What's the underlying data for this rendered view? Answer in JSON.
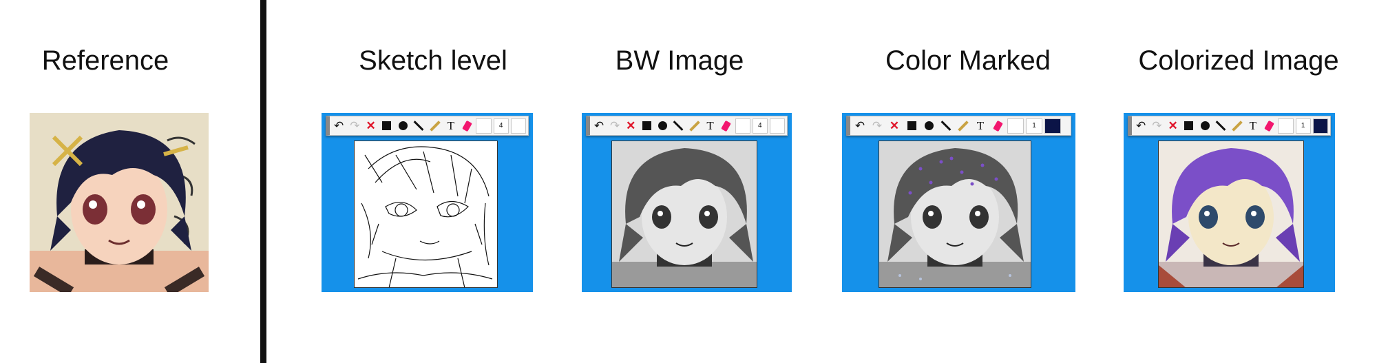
{
  "columns": {
    "reference": "Reference",
    "sketch": "Sketch level",
    "bw": "BW Image",
    "marked": "Color Marked",
    "colorized": "Colorized Image"
  },
  "toolbar": {
    "undo": "↶",
    "redo": "↷",
    "clear": "✕",
    "text_tool": "T",
    "size_sketch": "4",
    "size_bw": "4",
    "size_marked": "1",
    "size_colorized": "1"
  },
  "colors": {
    "panel_bg": "#1591ea",
    "clear_red": "#e0162b",
    "eraser_pink": "#f2166e",
    "pencil_gold": "#c9a343",
    "marker_navy": "#0b1447",
    "hair_purple": "#7b4fc8"
  }
}
